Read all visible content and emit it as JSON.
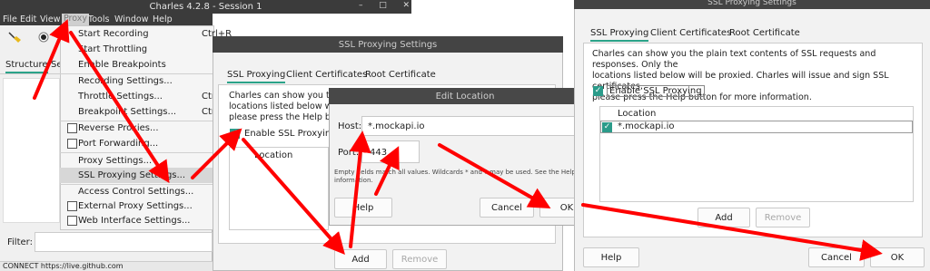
{
  "main_window": {
    "title": "Charles 4.2.8 - Session 1",
    "controls": [
      "–",
      "□",
      "✕"
    ],
    "menu": [
      "File",
      "Edit",
      "View",
      "Proxy",
      "Tools",
      "Window",
      "Help"
    ],
    "tabs": [
      "Structure",
      "Se"
    ],
    "filter_label": "Filter:",
    "status": "CONNECT https://live.github.com"
  },
  "proxy_menu": [
    {
      "label": "Start Recording",
      "shortcut": "Ctrl+R"
    },
    {
      "label": "Start Throttling"
    },
    {
      "label": "Enable Breakpoints"
    },
    {
      "label": "Recording Settings..."
    },
    {
      "label": "Throttle Settings...",
      "shortcut": "Ctrl+S"
    },
    {
      "label": "Breakpoint Settings...",
      "shortcut": "Ctrl+S"
    },
    {
      "label": "Reverse Proxies..."
    },
    {
      "label": "Port Forwarding..."
    },
    {
      "label": "Proxy Settings..."
    },
    {
      "label": "SSL Proxying Settings..."
    },
    {
      "label": "Access Control Settings..."
    },
    {
      "label": "External Proxy Settings..."
    },
    {
      "label": "Web Interface Settings..."
    }
  ],
  "ssl_dialog_1": {
    "title": "SSL Proxying Settings",
    "tabs": [
      "SSL Proxying",
      "Client Certificates",
      "Root Certificate"
    ],
    "desc": [
      "Charles can show you the p",
      "locations listed below will",
      "please press the Help butto"
    ],
    "enable_label": "Enable SSL Proxying",
    "column": "Location",
    "add": "Add",
    "remove": "Remove"
  },
  "edit_location": {
    "title": "Edit Location",
    "host_label": "Host:",
    "host_value": "*.mockapi.io",
    "port_label": "Port:",
    "port_value": "443",
    "hint": [
      "Empty fields match all values. Wildcards * and ? may be used. See the Help for more",
      "information."
    ],
    "help": "Help",
    "cancel": "Cancel",
    "ok": "OK"
  },
  "ssl_dialog_2": {
    "title": "SSL Proxying Settings",
    "tabs": [
      "SSL Proxying",
      "Client Certificates",
      "Root Certificate"
    ],
    "desc": [
      "Charles can show you the plain text contents of SSL requests and responses. Only the",
      "locations listed below will be proxied. Charles will issue and sign SSL certificates,",
      "please press the Help button for more information."
    ],
    "enable_label": "Enable SSL Proxying",
    "column": "Location",
    "row": "*.mockapi.io",
    "add": "Add",
    "remove": "Remove",
    "help": "Help",
    "cancel": "Cancel",
    "ok": "OK"
  },
  "colors": {
    "accent": "#2ba389",
    "arrow": "#ff0000",
    "titlebar": "#3b3b3b"
  }
}
